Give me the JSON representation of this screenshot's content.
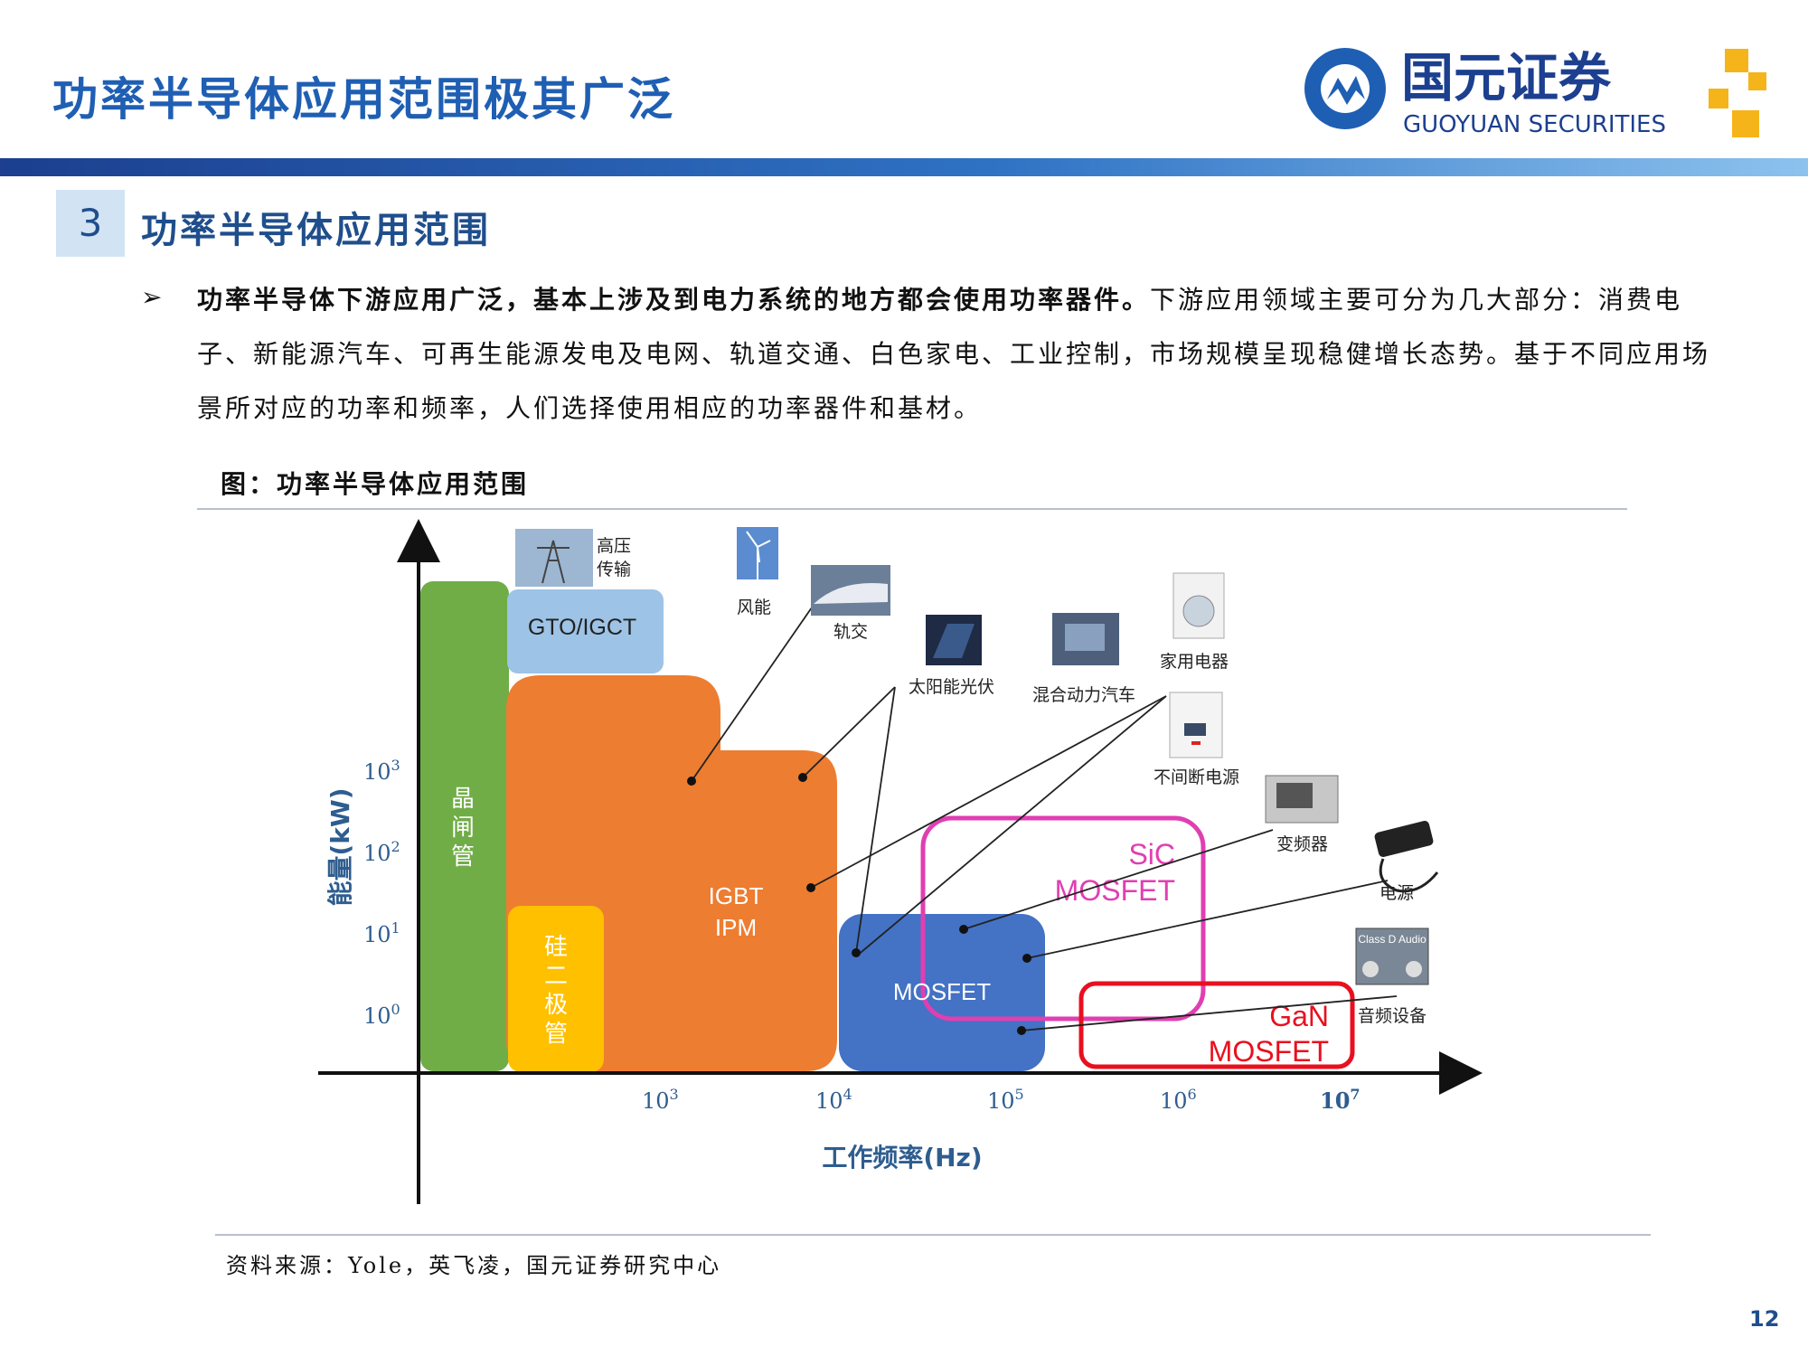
{
  "header": {
    "title": "功率半导体应用范围极其广泛",
    "logo": {
      "name_cn": "国元证券",
      "name_en": "GUOYUAN SECURITIES"
    }
  },
  "section": {
    "number": "3",
    "title": "功率半导体应用范围"
  },
  "body": {
    "bold_text": "功率半导体下游应用广泛，基本上涉及到电力系统的地方都会使用功率器件。",
    "rest_text": "下游应用领域主要可分为几大部分：消费电子、新能源汽车、可再生能源发电及电网、轨道交通、白色家电、工业控制，市场规模呈现稳健增长态势。基于不同应用场景所对应的功率和频率，人们选择使用相应的功率器件和基材。"
  },
  "figure": {
    "title": "图：功率半导体应用范围",
    "axes": {
      "ylabel": "能量(kW)",
      "xlabel": "工作频率(Hz)",
      "y_ticks": [
        {
          "base": "10",
          "exp": "3"
        },
        {
          "base": "10",
          "exp": "2"
        },
        {
          "base": "10",
          "exp": "1"
        },
        {
          "base": "10",
          "exp": "0"
        }
      ],
      "x_ticks": [
        {
          "base": "10",
          "exp": "3"
        },
        {
          "base": "10",
          "exp": "4"
        },
        {
          "base": "10",
          "exp": "5"
        },
        {
          "base": "10",
          "exp": "6"
        },
        {
          "base": "10",
          "exp": "7"
        }
      ]
    },
    "devices": {
      "thyristor": "晶闸管",
      "gto": "GTO/IGCT",
      "diode": "硅二极管",
      "igbt": [
        "IGBT",
        "IPM"
      ],
      "mosfet": "MOSFET",
      "sic": [
        "SiC",
        "MOSFET"
      ],
      "gan": [
        "GaN",
        "MOSFET"
      ]
    },
    "applications": {
      "hv": [
        "高压",
        "传输"
      ],
      "wind": "风能",
      "rail": "轨交",
      "solar": "太阳能光伏",
      "hybrid": "混合动力汽车",
      "appliance": "家用电器",
      "ups": "不间断电源",
      "inverter": "变频器",
      "power": "电源",
      "audio": "音频设备",
      "audio_badge": "Class D Audio"
    },
    "colors": {
      "thyristor": "#70ad47",
      "gto": "#9dc3e6",
      "igbt": "#ed7d31",
      "diode": "#ffc000",
      "mosfet": "#4472c4",
      "sic": "#e03fb2",
      "gan": "#e8101f",
      "axis_label": "#2e5d8f"
    }
  },
  "source": "资料来源：Yole，英飞凌，国元证券研究中心",
  "page_number": "12"
}
